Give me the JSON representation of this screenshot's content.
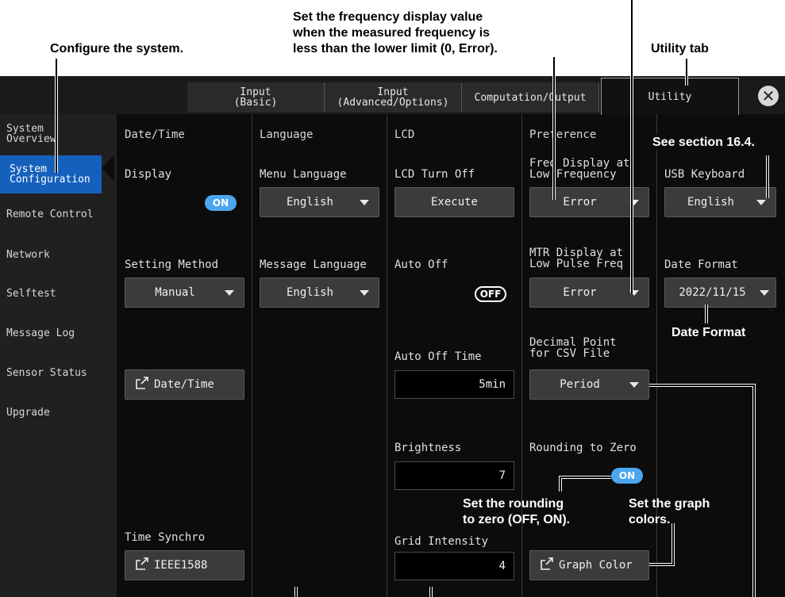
{
  "annotations": {
    "configure_system": "Configure the system.",
    "freq_display_line1": "Set the frequency display value",
    "freq_display_line2": "when the measured frequency is",
    "freq_display_line3": "less than the lower limit (0, Error).",
    "utility_tab": "Utility tab",
    "see_section": "See section 16.4.",
    "date_format": "Date Format",
    "rounding_line1": "Set the rounding",
    "rounding_line2": "to zero (OFF, ON).",
    "graph_colors_line1": "Set the graph",
    "graph_colors_line2": "colors."
  },
  "tabs": [
    {
      "label": "Input\n(Basic)"
    },
    {
      "label": "Input\n(Advanced/Options)"
    },
    {
      "label": "Computation/Output"
    },
    {
      "label": "Utility"
    }
  ],
  "sidebar": {
    "items": [
      {
        "label": "System\nOverview"
      },
      {
        "label": "System\nConfiguration"
      },
      {
        "label": "Remote Control"
      },
      {
        "label": "Network"
      },
      {
        "label": "Selftest"
      },
      {
        "label": "Message Log"
      },
      {
        "label": "Sensor Status"
      },
      {
        "label": "Upgrade"
      }
    ]
  },
  "datetime": {
    "header": "Date/Time",
    "display_label": "Display",
    "display_state": "ON",
    "setting_method_label": "Setting Method",
    "setting_method_value": "Manual",
    "datetime_button": "Date/Time",
    "time_synchro_label": "Time Synchro",
    "time_synchro_value": "IEEE1588"
  },
  "language": {
    "header": "Language",
    "menu_language_label": "Menu Language",
    "menu_language_value": "English",
    "message_language_label": "Message Language",
    "message_language_value": "English"
  },
  "lcd": {
    "header": "LCD",
    "turn_off_label": "LCD Turn Off",
    "execute_button": "Execute",
    "auto_off_label": "Auto Off",
    "auto_off_state": "OFF",
    "auto_off_time_label": "Auto Off Time",
    "auto_off_time_value": "5min",
    "brightness_label": "Brightness",
    "brightness_value": "7",
    "grid_intensity_label": "Grid Intensity",
    "grid_intensity_value": "4"
  },
  "preference": {
    "header": "Preference",
    "freq_display_label": "Freq Display at\nLow Frequency",
    "freq_display_value": "Error",
    "mtr_display_label": "MTR Display at\nLow Pulse Freq",
    "mtr_display_value": "Error",
    "decimal_point_label": "Decimal Point\nfor CSV File",
    "decimal_point_value": "Period",
    "rounding_label": "Rounding to Zero",
    "rounding_state": "ON",
    "graph_color_button": "Graph Color"
  },
  "utility": {
    "usb_keyboard_label": "USB Keyboard",
    "usb_keyboard_value": "English",
    "date_format_label": "Date Format",
    "date_format_value": "2022/11/15"
  },
  "icons": {
    "close": "close-icon",
    "external_dialog": "external-dialog-icon",
    "dropdown": "chevron-down-icon"
  }
}
